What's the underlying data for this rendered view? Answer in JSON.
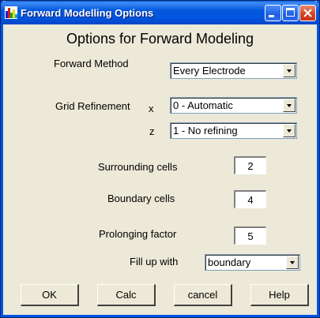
{
  "window": {
    "title": "Forward Modelling Options"
  },
  "heading": "Options for Forward Modeling",
  "forward_method": {
    "label": "Forward Method",
    "value": "Every Electrode"
  },
  "grid_refinement": {
    "label": "Grid Refinement",
    "x_label": "x",
    "x_value": "0 - Automatic",
    "z_label": "z",
    "z_value": "1 - No refining"
  },
  "surrounding_cells": {
    "label": "Surrounding cells",
    "value": "2"
  },
  "boundary_cells": {
    "label": "Boundary cells",
    "value": "4"
  },
  "prolonging_factor": {
    "label": "Prolonging factor",
    "value": "5"
  },
  "fill_up": {
    "label": "Fill up with",
    "value": "boundary"
  },
  "buttons": {
    "ok": "OK",
    "calc": "Calc",
    "cancel": "cancel",
    "help": "Help"
  },
  "icon_names": [
    "app-chart-icon",
    "minimize-icon",
    "maximize-icon",
    "close-icon",
    "dropdown-arrow-icon"
  ]
}
